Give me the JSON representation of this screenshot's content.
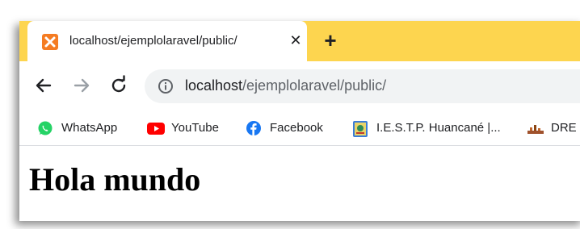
{
  "browser": {
    "tab": {
      "title": "localhost/ejemplolaravel/public/",
      "favicon": "xampp-icon",
      "close_label": "✕"
    },
    "new_tab_label": "+",
    "tabstrip_color": "#fdd54f",
    "nav": {
      "back": "arrow-back-icon",
      "forward": "arrow-forward-icon",
      "reload": "reload-icon"
    },
    "address": {
      "security_icon": "info-icon",
      "host": "localhost",
      "path": "/ejemplolaravel/public/"
    },
    "bookmarks": [
      {
        "label": "WhatsApp",
        "icon": "whatsapp-icon",
        "color": "#25d366"
      },
      {
        "label": "YouTube",
        "icon": "youtube-icon",
        "color": "#ff0000"
      },
      {
        "label": "Facebook",
        "icon": "facebook-icon",
        "color": "#1877f2"
      },
      {
        "label": "I.E.S.T.P. Huancané |...",
        "icon": "iestp-icon",
        "color": "#3b7dd8"
      },
      {
        "label": "DRE",
        "icon": "dre-icon",
        "color": "#a0522d"
      }
    ]
  },
  "page": {
    "heading": "Hola mundo"
  }
}
